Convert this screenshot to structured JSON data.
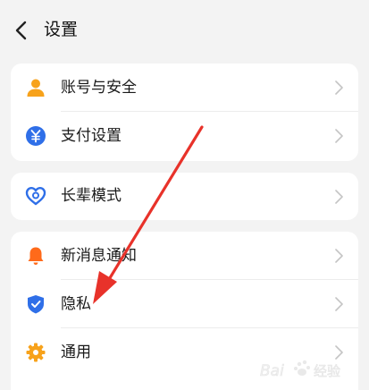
{
  "header": {
    "title": "设置"
  },
  "groups": [
    {
      "items": [
        {
          "label": "账号与安全",
          "icon": "person-icon"
        },
        {
          "label": "支付设置",
          "icon": "yuan-icon"
        }
      ]
    },
    {
      "items": [
        {
          "label": "长辈模式",
          "icon": "heart-icon"
        }
      ]
    },
    {
      "items": [
        {
          "label": "新消息通知",
          "icon": "bell-icon"
        },
        {
          "label": "隐私",
          "icon": "shield-check-icon"
        },
        {
          "label": "通用",
          "icon": "gear-icon"
        }
      ]
    }
  ],
  "colors": {
    "accent_orange": "#f7a21b",
    "accent_blue": "#2f6fe8",
    "bell_orange": "#ff6a1a",
    "annotation_red": "#e8322a"
  },
  "watermark": {
    "text": "Baidu 经验"
  }
}
